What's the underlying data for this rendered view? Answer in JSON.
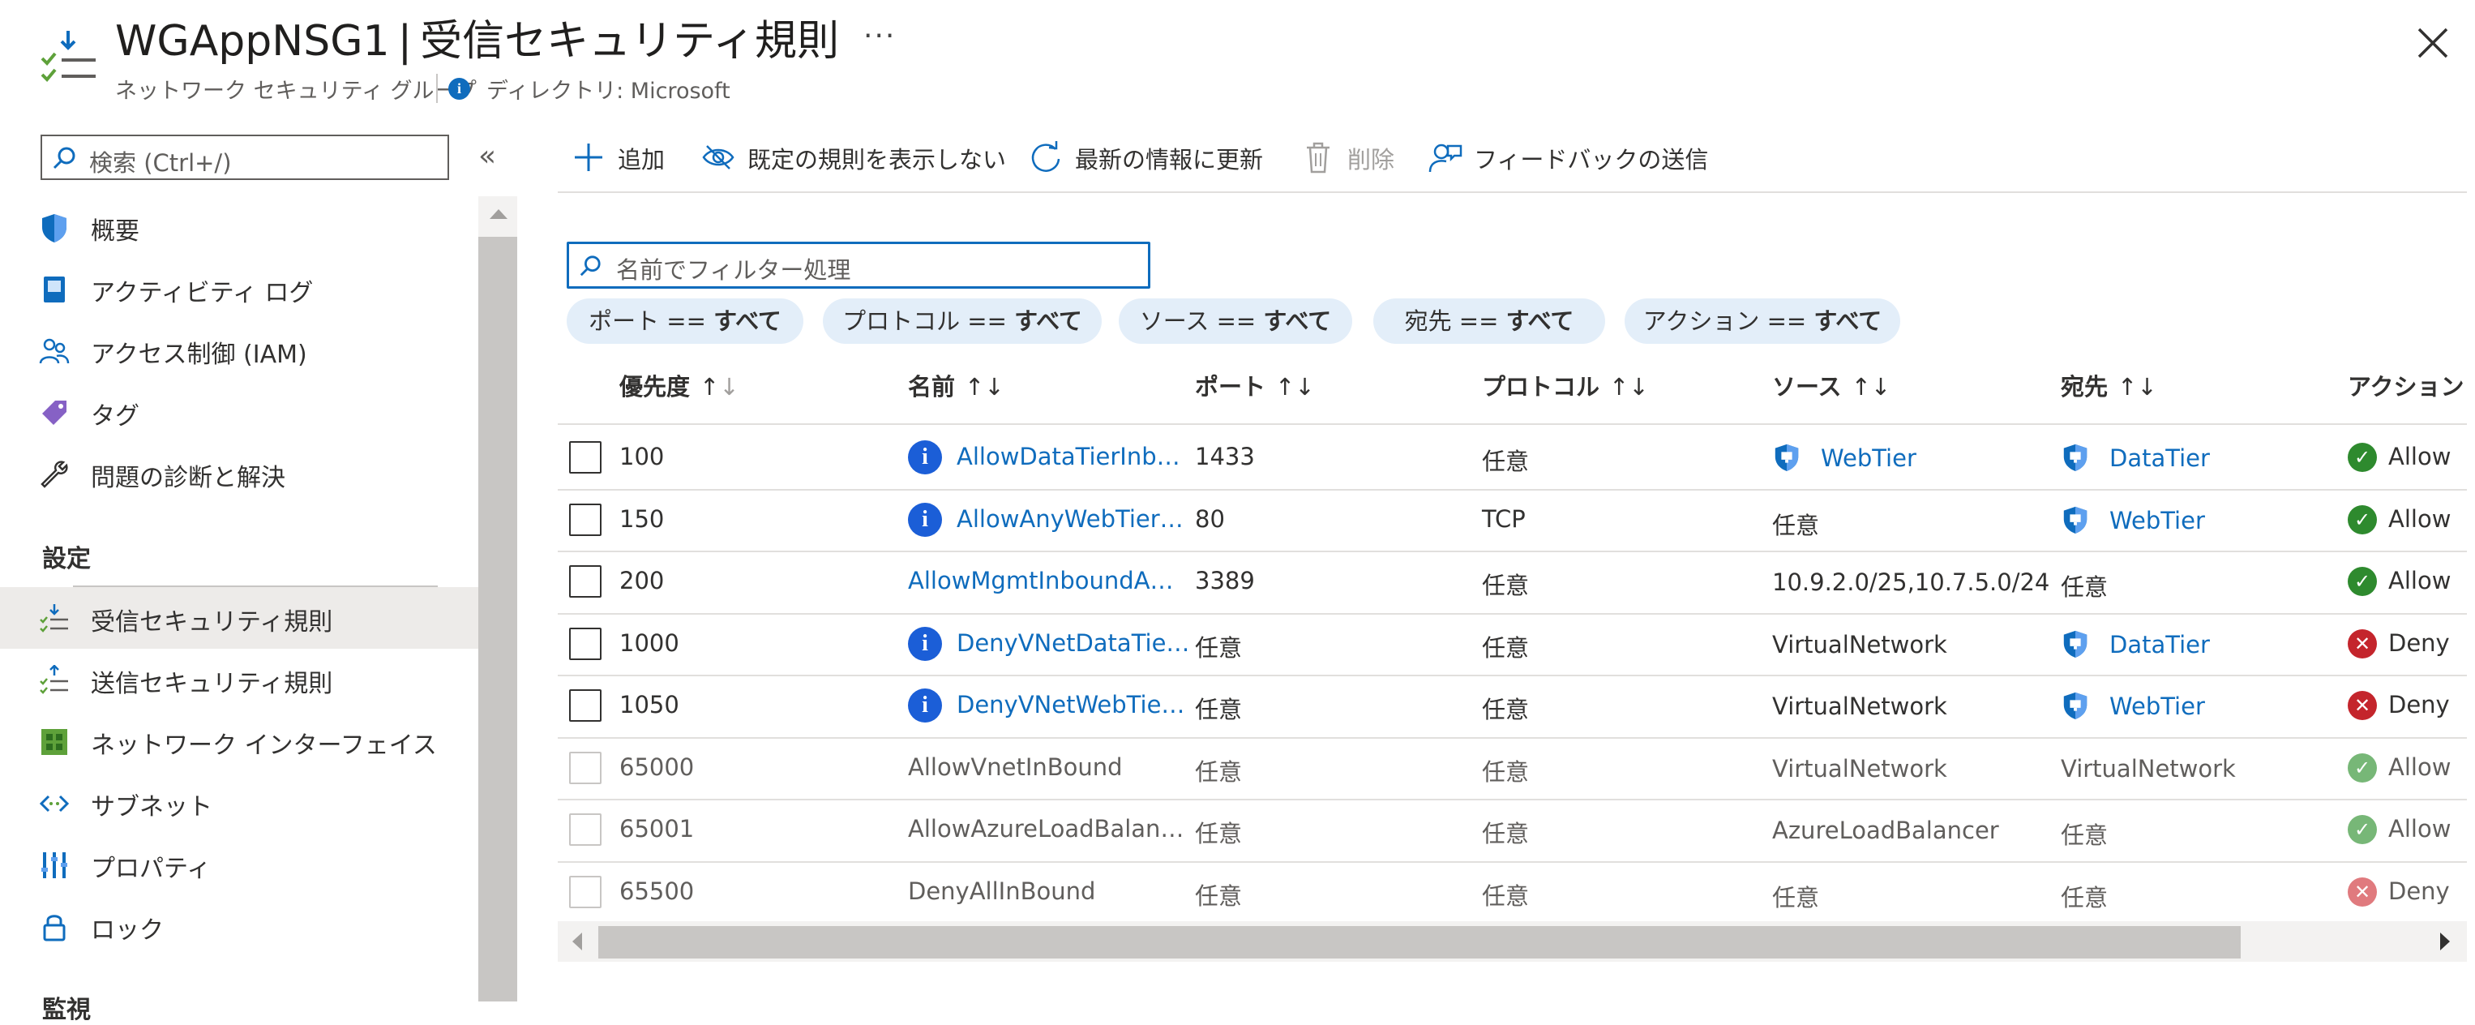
{
  "header": {
    "title_name": "WGAppNSG1",
    "title_sep": "|",
    "title_page": "受信セキュリティ規則",
    "more": "···",
    "subtitle": "ネットワーク セキュリティ グループ",
    "directory": "ディレクトリ: Microsoft"
  },
  "sidebar": {
    "search_placeholder": "検索 (Ctrl+/)",
    "collapse": "«",
    "items": [
      {
        "label": "概要",
        "icon": "shield-icon"
      },
      {
        "label": "アクティビティ ログ",
        "icon": "activity-log-icon"
      },
      {
        "label": "アクセス制御 (IAM)",
        "icon": "people-icon"
      },
      {
        "label": "タグ",
        "icon": "tag-icon"
      },
      {
        "label": "問題の診断と解決",
        "icon": "wrench-icon"
      }
    ],
    "section_label": "設定",
    "settings_items": [
      {
        "label": "受信セキュリティ規則",
        "icon": "inbound-rules-icon",
        "active": true
      },
      {
        "label": "送信セキュリティ規則",
        "icon": "outbound-rules-icon"
      },
      {
        "label": "ネットワーク インターフェイス",
        "icon": "network-interface-icon"
      },
      {
        "label": "サブネット",
        "icon": "subnet-icon"
      },
      {
        "label": "プロパティ",
        "icon": "properties-icon"
      },
      {
        "label": "ロック",
        "icon": "lock-icon"
      }
    ],
    "cut_off_label": "監視"
  },
  "toolbar": {
    "add": "追加",
    "hide_defaults": "既定の規則を表示しない",
    "refresh": "最新の情報に更新",
    "delete": "削除",
    "feedback": "フィードバックの送信"
  },
  "filter": {
    "placeholder": "名前でフィルター処理",
    "pills": [
      {
        "key": "ポート",
        "op": "==",
        "value": "すべて"
      },
      {
        "key": "プロトコル",
        "op": "==",
        "value": "すべて"
      },
      {
        "key": "ソース",
        "op": "==",
        "value": "すべて"
      },
      {
        "key": "宛先",
        "op": "==",
        "value": "すべて"
      },
      {
        "key": "アクション",
        "op": "==",
        "value": "すべて"
      }
    ]
  },
  "table": {
    "columns": [
      "優先度",
      "名前",
      "ポート",
      "プロトコル",
      "ソース",
      "宛先",
      "アクション"
    ],
    "rows": [
      {
        "priority": "100",
        "name": "AllowDataTierInb…",
        "name_info": true,
        "port": "1433",
        "protocol": "任意",
        "source": "WebTier",
        "source_tag": true,
        "dest": "DataTier",
        "dest_tag": true,
        "action": "Allow",
        "default": false
      },
      {
        "priority": "150",
        "name": "AllowAnyWebTier…",
        "name_info": true,
        "port": "80",
        "protocol": "TCP",
        "source": "任意",
        "source_tag": false,
        "dest": "WebTier",
        "dest_tag": true,
        "action": "Allow",
        "default": false
      },
      {
        "priority": "200",
        "name": "AllowMgmtInboundA…",
        "name_info": false,
        "port": "3389",
        "protocol": "任意",
        "source": "10.9.2.0/25,10.7.5.0/24",
        "source_tag": false,
        "dest": "任意",
        "dest_tag": false,
        "action": "Allow",
        "default": false
      },
      {
        "priority": "1000",
        "name": "DenyVNetDataTie…",
        "name_info": true,
        "port": "任意",
        "protocol": "任意",
        "source": "VirtualNetwork",
        "source_tag": false,
        "dest": "DataTier",
        "dest_tag": true,
        "action": "Deny",
        "default": false
      },
      {
        "priority": "1050",
        "name": "DenyVNetWebTie…",
        "name_info": true,
        "port": "任意",
        "protocol": "任意",
        "source": "VirtualNetwork",
        "source_tag": false,
        "dest": "WebTier",
        "dest_tag": true,
        "action": "Deny",
        "default": false
      },
      {
        "priority": "65000",
        "name": "AllowVnetInBound",
        "name_info": false,
        "port": "任意",
        "protocol": "任意",
        "source": "VirtualNetwork",
        "source_tag": false,
        "dest": "VirtualNetwork",
        "dest_tag": false,
        "action": "Allow",
        "default": true
      },
      {
        "priority": "65001",
        "name": "AllowAzureLoadBalan…",
        "name_info": false,
        "port": "任意",
        "protocol": "任意",
        "source": "AzureLoadBalancer",
        "source_tag": false,
        "dest": "任意",
        "dest_tag": false,
        "action": "Allow",
        "default": true
      },
      {
        "priority": "65500",
        "name": "DenyAllInBound",
        "name_info": false,
        "port": "任意",
        "protocol": "任意",
        "source": "任意",
        "source_tag": false,
        "dest": "任意",
        "dest_tag": false,
        "action": "Deny",
        "default": true
      }
    ]
  },
  "colors": {
    "accent": "#0f6cbd",
    "allow": "#2e8a2e",
    "deny": "#c4252c",
    "pill_bg": "#e3eef9",
    "active_nav": "#edebe9"
  }
}
